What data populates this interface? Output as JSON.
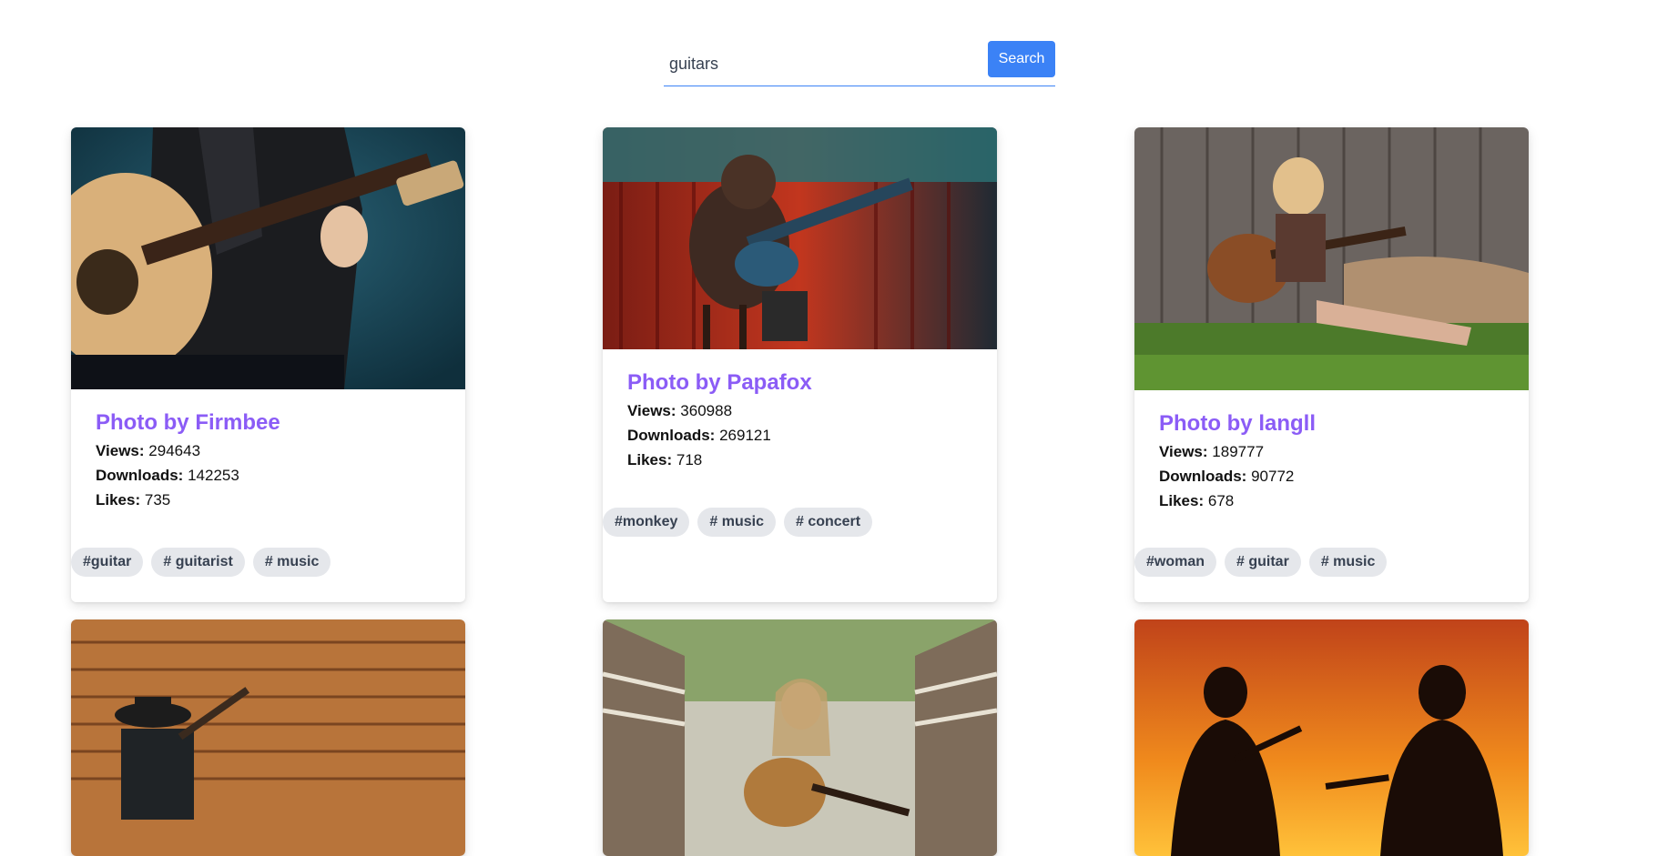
{
  "search": {
    "value": "guitars",
    "button_label": "Search"
  },
  "cards": [
    {
      "title": "Photo by Firmbee",
      "views_label": "Views:",
      "views": "294643",
      "downloads_label": "Downloads:",
      "downloads": "142253",
      "likes_label": "Likes:",
      "likes": "735",
      "tags": [
        "#guitar",
        "# guitarist",
        "# music"
      ]
    },
    {
      "title": "Photo by Papafox",
      "views_label": "Views:",
      "views": "360988",
      "downloads_label": "Downloads:",
      "downloads": "269121",
      "likes_label": "Likes:",
      "likes": "718",
      "tags": [
        "#monkey",
        "# music",
        "# concert"
      ]
    },
    {
      "title": "Photo by langll",
      "views_label": "Views:",
      "views": "189777",
      "downloads_label": "Downloads:",
      "downloads": "90772",
      "likes_label": "Likes:",
      "likes": "678",
      "tags": [
        "#woman",
        "# guitar",
        "# music"
      ]
    }
  ],
  "colors": {
    "accent": "#3b82f6",
    "title": "#8b5cf6",
    "tag_bg": "#e5e7eb"
  }
}
